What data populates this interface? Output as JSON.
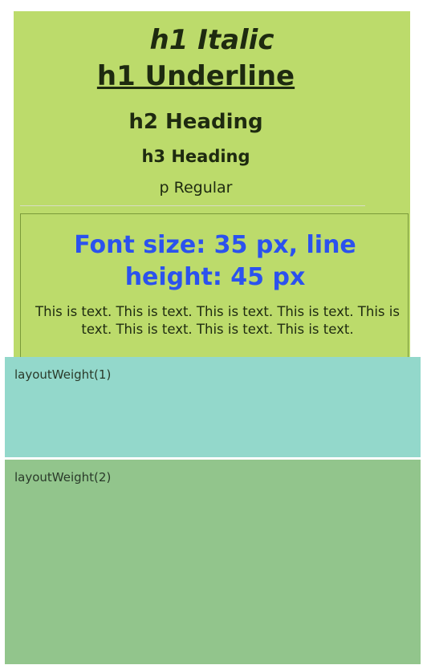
{
  "headings": {
    "h1_italic": "h1 Italic",
    "h1_underline": "h1 Underline",
    "h2": "h2 Heading",
    "h3": "h3 Heading",
    "p": "p Regular"
  },
  "styled_box": {
    "title": "Font size: 35 px, line height: 45 px",
    "body": "This is text. This is text. This is text. This is text. This is text. This is text. This is text. This is text."
  },
  "layout_weight_panels": [
    {
      "label": "layoutWeight(1)"
    },
    {
      "label": "layoutWeight(2)"
    }
  ],
  "colors": {
    "green_panel": "#bcdb6b",
    "teal_panel": "#93d8cb",
    "green2_panel": "#92c58c",
    "accent_blue": "#2b52ee"
  }
}
